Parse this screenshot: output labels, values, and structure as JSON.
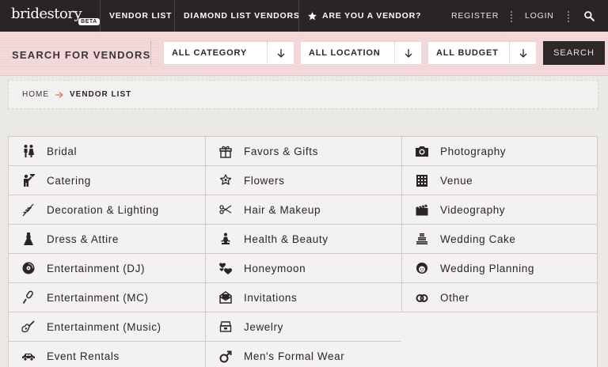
{
  "header": {
    "logo_text": "bridestory",
    "logo_badge": "BETA",
    "nav": [
      "VENDOR LIST",
      "DIAMOND LIST VENDORS",
      "ARE YOU A VENDOR?"
    ],
    "register": "REGISTER",
    "login": "LOGIN",
    "search_icon": "search-icon"
  },
  "search": {
    "title": "SEARCH FOR VENDORS",
    "category": "ALL CATEGORY",
    "location": "ALL LOCATION",
    "budget": "ALL BUDGET",
    "button": "SEARCH"
  },
  "breadcrumb": {
    "home": "HOME",
    "current": "VENDOR LIST"
  },
  "categories": {
    "col1": [
      {
        "label": "Bridal",
        "icon": "couple-icon"
      },
      {
        "label": "Catering",
        "icon": "waiter-icon"
      },
      {
        "label": "Decoration & Lighting",
        "icon": "leaf-icon"
      },
      {
        "label": "Dress & Attire",
        "icon": "dress-icon"
      },
      {
        "label": "Entertainment (DJ)",
        "icon": "vinyl-icon"
      },
      {
        "label": "Entertainment (MC)",
        "icon": "microphone-icon"
      },
      {
        "label": "Entertainment (Music)",
        "icon": "guitar-icon"
      },
      {
        "label": "Event Rentals",
        "icon": "car-icon"
      }
    ],
    "col2": [
      {
        "label": "Favors & Gifts",
        "icon": "gift-icon"
      },
      {
        "label": "Flowers",
        "icon": "flower-icon"
      },
      {
        "label": "Hair & Makeup",
        "icon": "scissors-icon"
      },
      {
        "label": "Health & Beauty",
        "icon": "yoga-icon"
      },
      {
        "label": "Honeymoon",
        "icon": "hearts-icon"
      },
      {
        "label": "Invitations",
        "icon": "envelope-icon"
      },
      {
        "label": "Jewelry",
        "icon": "jewelry-box-icon"
      },
      {
        "label": "Men's Formal Wear",
        "icon": "male-icon"
      }
    ],
    "col3": [
      {
        "label": "Photography",
        "icon": "camera-icon"
      },
      {
        "label": "Venue",
        "icon": "building-icon"
      },
      {
        "label": "Videography",
        "icon": "clapperboard-icon"
      },
      {
        "label": "Wedding Cake",
        "icon": "cake-icon"
      },
      {
        "label": "Wedding Planning",
        "icon": "planner-icon"
      },
      {
        "label": "Other",
        "icon": "rings-icon"
      }
    ]
  }
}
